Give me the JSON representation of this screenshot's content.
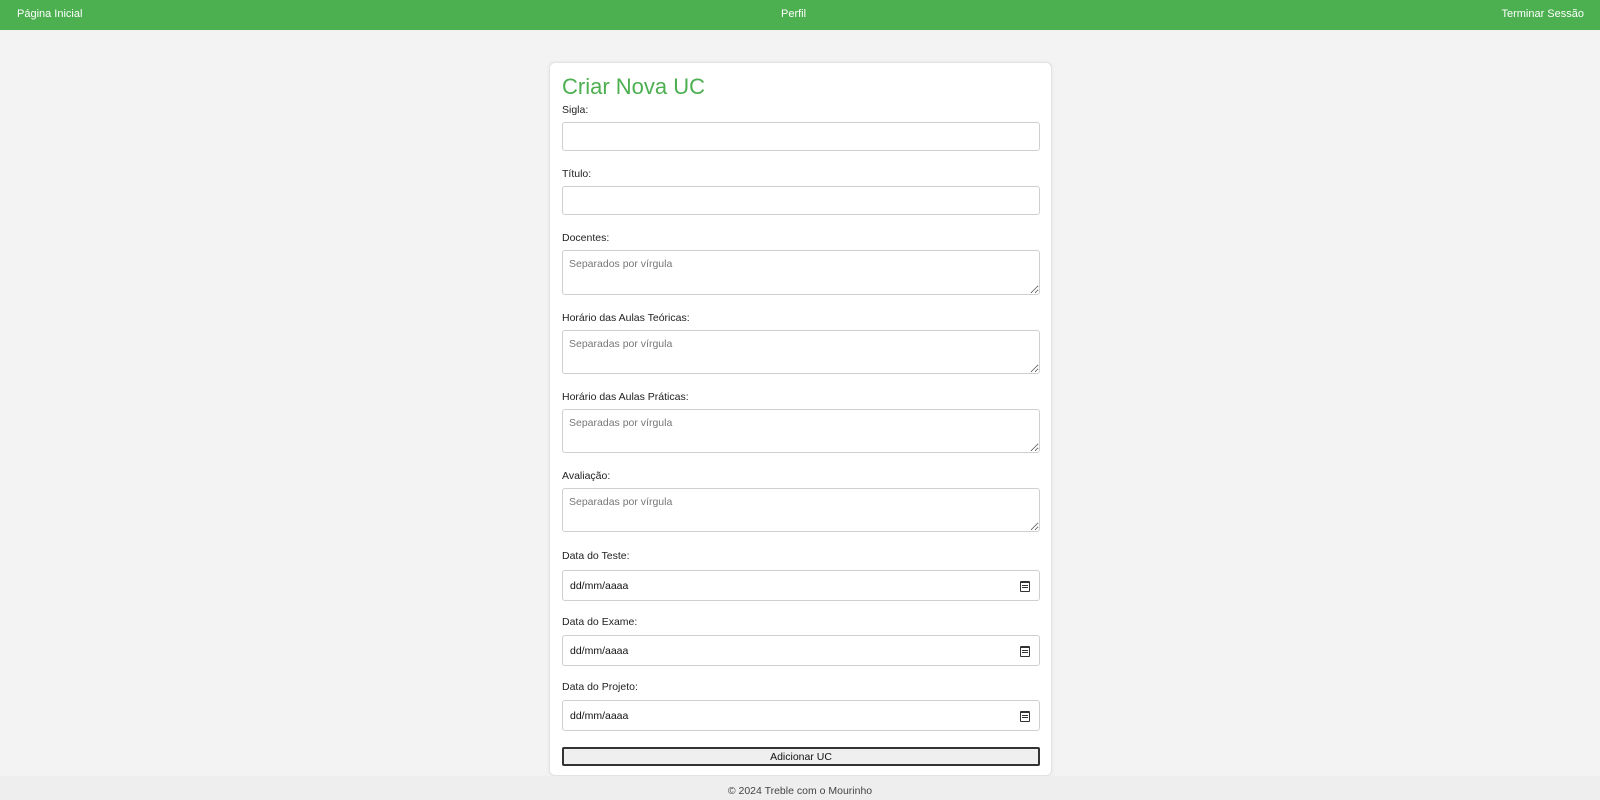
{
  "nav": {
    "home": "Página Inicial",
    "profile": "Perfil",
    "logout": "Terminar Sessão"
  },
  "form": {
    "title": "Criar Nova UC",
    "sigla_label": "Sigla:",
    "sigla_value": "",
    "titulo_label": "Título:",
    "titulo_value": "",
    "docentes_label": "Docentes:",
    "docentes_placeholder": "Separados por vírgula",
    "teoricas_label": "Horário das Aulas Teóricas:",
    "teoricas_placeholder": "Separadas por vírgula",
    "praticas_label": "Horário das Aulas Práticas:",
    "praticas_placeholder": "Separadas por vírgula",
    "avaliacao_label": "Avaliação:",
    "avaliacao_placeholder": "Separadas por vírgula",
    "teste_label": "Data do Teste:",
    "teste_value": "dd/mm/aaaa",
    "exame_label": "Data do Exame:",
    "exame_value": "dd/mm/aaaa",
    "projeto_label": "Data do Projeto:",
    "projeto_value": "dd/mm/aaaa",
    "submit_label": "Adicionar UC"
  },
  "footer": {
    "text": "© 2024 Treble com o Mourinho"
  },
  "colors": {
    "accent": "#4caf50",
    "background": "#f3f3f3"
  },
  "icons": {
    "date_picker": "calendar-icon"
  }
}
